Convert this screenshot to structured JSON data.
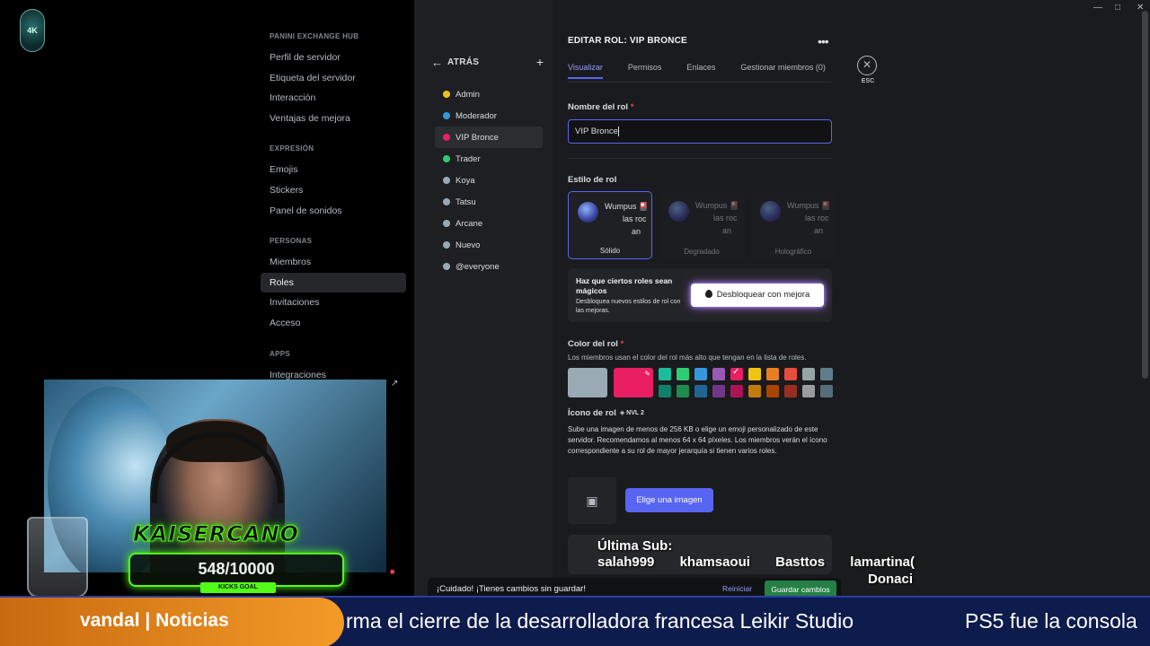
{
  "server": {
    "logo_text": "4K"
  },
  "settings_nav": {
    "sections": [
      {
        "title": "PANINI EXCHANGE HUB",
        "items": [
          "Perfil de servidor",
          "Etiqueta del servidor",
          "Interacción",
          "Ventajas de mejora"
        ]
      },
      {
        "title": "EXPRESIÓN",
        "items": [
          "Emojis",
          "Stickers",
          "Panel de sonidos"
        ]
      },
      {
        "title": "PERSONAS",
        "items": [
          "Miembros",
          "Roles",
          "Invitaciones",
          "Acceso"
        ]
      },
      {
        "title": "APPS",
        "items": [
          "Integraciones"
        ]
      }
    ],
    "active": "Roles"
  },
  "roles_panel": {
    "back_label": "ATRÁS",
    "roles": [
      {
        "name": "Admin",
        "color": "#f0c419"
      },
      {
        "name": "Moderador",
        "color": "#3498db"
      },
      {
        "name": "VIP Bronce",
        "color": "#e91e63"
      },
      {
        "name": "Trader",
        "color": "#2ecc71"
      },
      {
        "name": "Koya",
        "color": "#99aab5"
      },
      {
        "name": "Tatsu",
        "color": "#99aab5"
      },
      {
        "name": "Arcane",
        "color": "#99aab5"
      },
      {
        "name": "Nuevo",
        "color": "#99aab5"
      },
      {
        "name": "@everyone",
        "color": "#99aab5"
      }
    ],
    "active_role": "VIP Bronce"
  },
  "editor": {
    "title": "EDITAR ROL: VIP BRONCE",
    "tabs": [
      "Visualizar",
      "Permisos",
      "Enlaces",
      "Gestionar miembros (0)"
    ],
    "active_tab": "Visualizar",
    "esc_label": "ESC",
    "name_label": "Nombre del rol",
    "name_value": "VIP Bronce",
    "style_label": "Estilo de rol",
    "style_preview_lines": [
      "Wumpus 🎴",
      "las roc",
      "an"
    ],
    "styles": [
      "Sólido",
      "Degradado",
      "Holográfico"
    ],
    "magic": {
      "title": "Haz que ciertos roles sean mágicos",
      "subtitle": "Desbloquea nuevos estilos de rol con las mejoras.",
      "button": "Desbloquear con mejora"
    },
    "color_label": "Color del rol",
    "color_hint": "Los miembros usan el color del rol más alto que tengan en la lista de roles.",
    "default_color": "#99aab5",
    "selected_color": "#e91e63",
    "swatches_top": [
      "#1abc9c",
      "#2ecc71",
      "#3498db",
      "#9b59b6",
      "#e91e63",
      "#f1c40f",
      "#e67e22",
      "#e74c3c",
      "#95a5a6",
      "#607d8b"
    ],
    "swatches_bottom": [
      "#11806a",
      "#1f8b4c",
      "#206694",
      "#71368a",
      "#ad1457",
      "#c27c0e",
      "#a84300",
      "#992d22",
      "#979c9f",
      "#546e7a"
    ],
    "icon_label": "Ícono de rol",
    "icon_level": "NVL 2",
    "icon_desc": "Sube una imagen de menos de 256 KB o elige un emoji personalizado de este servidor. Recomendamos al menos 64 x 64 píxeles. Los miembros verán el ícono correspondiente a su rol de mayor jerarquía si tienen varios roles.",
    "choose_image": "Elige una imagen"
  },
  "unsaved_bar": {
    "text": "¡Cuidado! ¡Tienes cambios sin guardar!",
    "reset": "Reiniciar",
    "save": "Guardar cambios"
  },
  "stream_overlay": {
    "kick_name": "KAISERCANO",
    "goal_value": "548/10000",
    "goal_label": "KICKS GOAL",
    "last_sub_title": "Última Sub:",
    "sub_names": [
      "salah999",
      "khamsaoui",
      "Basttos",
      "lamartina("
    ],
    "donations_label": "Donaci",
    "ticker_label": "vandal | Noticias",
    "ticker_text": "rma el cierre de la desarrolladora francesa Leikir Studio",
    "ticker_text2": "PS5 fue la consola"
  }
}
